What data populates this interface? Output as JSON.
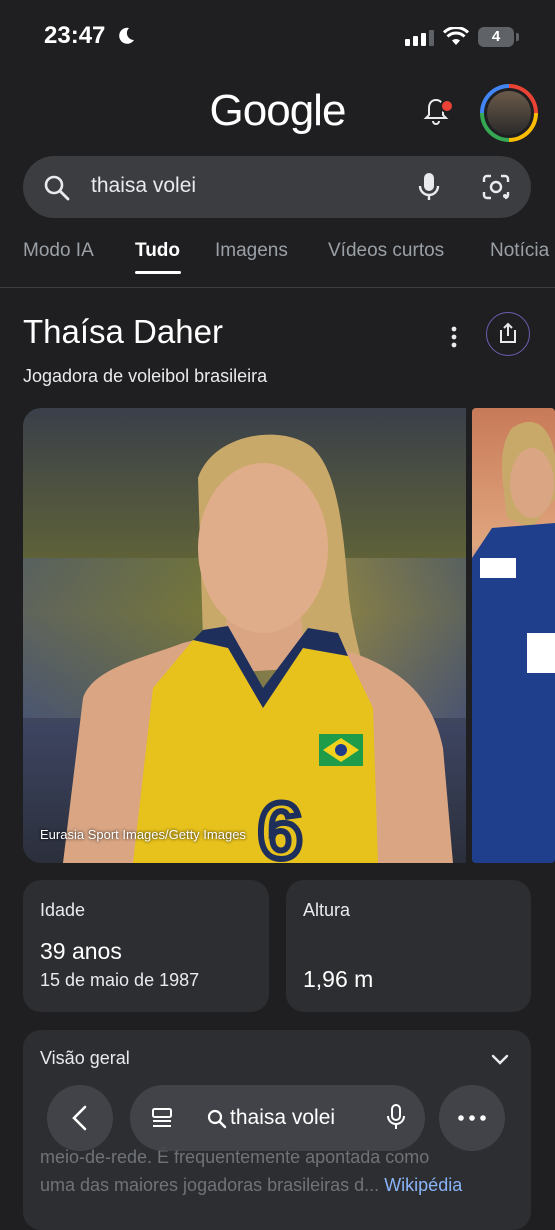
{
  "status": {
    "time": "23:47",
    "battery": "4"
  },
  "header": {
    "logo": "Google"
  },
  "search": {
    "query": "thaisa volei"
  },
  "tabs": [
    "Modo IA",
    "Tudo",
    "Imagens",
    "Vídeos curtos",
    "Notícia"
  ],
  "active_tab": "Tudo",
  "knowledge_panel": {
    "title": "Thaísa Daher",
    "subtitle": "Jogadora de voleibol brasileira",
    "image_credit": "Eurasia Sport Images/Getty Images"
  },
  "facts": {
    "age": {
      "label": "Idade",
      "value": "39 anos",
      "sub": "15 de maio de 1987"
    },
    "height": {
      "label": "Altura",
      "value": "1,96 m"
    }
  },
  "overview": {
    "title": "Visão geral",
    "text_partial": "Thaísa Daher ... meio-de-rede. É frequentemente apontada como uma das maiores jogadoras brasileiras d...",
    "line3": "meio-de-rede. É frequentemente apontada como",
    "line4": "uma das maiores jogadoras brasileiras d...",
    "source": "Wikipédia"
  },
  "bottom_bar": {
    "query": "thaisa volei"
  },
  "colors": {
    "background": "#1f1f21",
    "card": "#2d2e31",
    "accent_link": "#8ab4f8"
  }
}
